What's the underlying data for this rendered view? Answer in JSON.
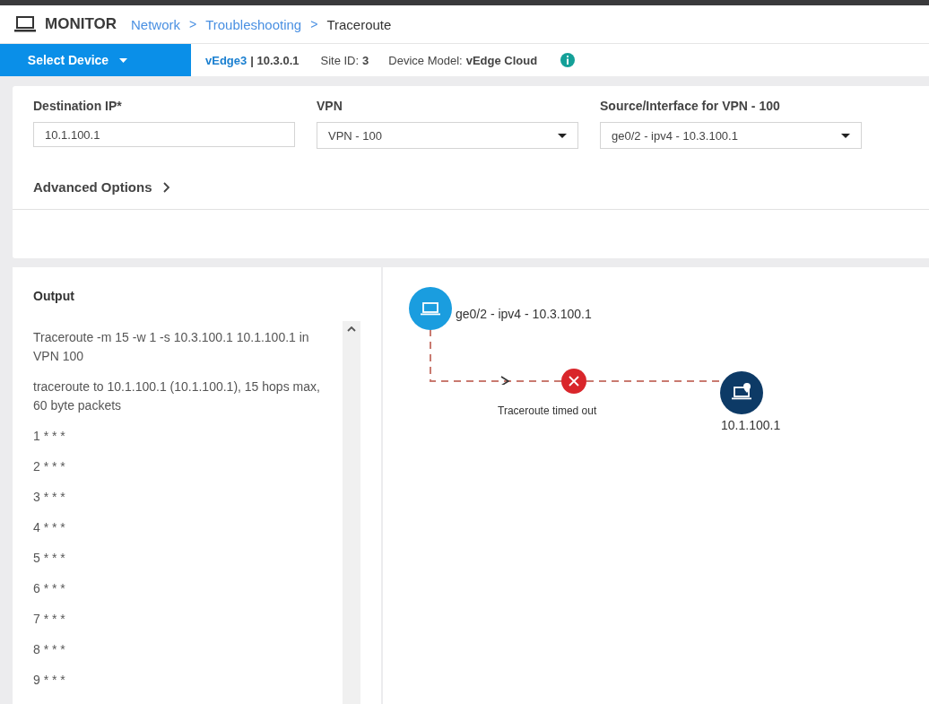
{
  "header": {
    "title": "MONITOR",
    "breadcrumbs": [
      {
        "label": "Network",
        "kind": "link"
      },
      {
        "label": "Troubleshooting",
        "kind": "link"
      },
      {
        "label": "Traceroute",
        "kind": "current"
      }
    ],
    "separator": ">"
  },
  "device_bar": {
    "select_label": "Select Device",
    "device_name": "vEdge3",
    "device_ip": "| 10.3.0.1",
    "site_label": "Site ID:",
    "site_value": "3",
    "model_label": "Device Model:",
    "model_value": "vEdge Cloud"
  },
  "form": {
    "fields": [
      {
        "label": "Destination IP*",
        "kind": "input",
        "value": "10.1.100.1"
      },
      {
        "label": "VPN",
        "kind": "select",
        "value": "VPN - 100"
      },
      {
        "label": "Source/Interface for VPN - 100",
        "kind": "select",
        "value": "ge0/2 - ipv4 - 10.3.100.1"
      }
    ],
    "advanced": {
      "label": "Advanced Options",
      "expanded": false
    }
  },
  "output": {
    "title": "Output",
    "lines": [
      "Traceroute -m 15 -w 1 -s 10.3.100.1 10.1.100.1 in VPN 100",
      "traceroute to 10.1.100.1 (10.1.100.1), 15 hops max, 60 byte packets",
      "1 * * *",
      "2 * * *",
      "3 * * *",
      "4 * * *",
      "5 * * *",
      "6 * * *",
      "7 * * *",
      "8 * * *",
      "9 * * *"
    ]
  },
  "diagram": {
    "source": "ge0/2 - ipv4 - 10.3.100.1",
    "destination": "10.1.100.1",
    "status": "Traceroute timed out",
    "failed": true
  }
}
